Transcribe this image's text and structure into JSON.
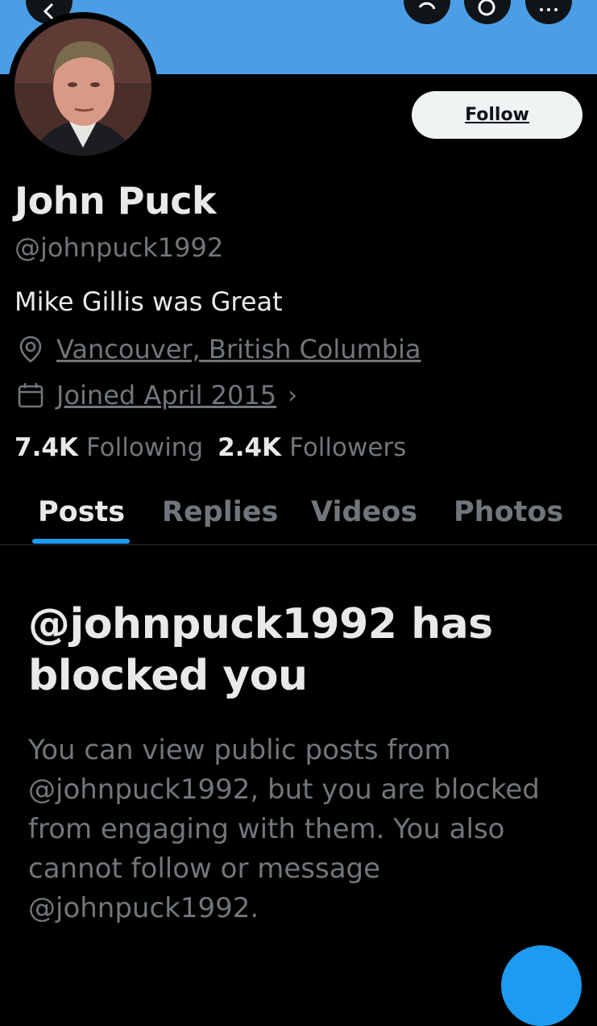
{
  "header": {
    "banner_color": "#4b9ee6",
    "icons": [
      "back-arrow-icon",
      "refresh-icon",
      "search-icon",
      "more-icon"
    ]
  },
  "profile": {
    "name": "John Puck",
    "handle": "@johnpuck1992",
    "bio": "Mike Gillis was Great",
    "location": "Vancouver, British Columbia",
    "joined": "Joined April 2015",
    "follow_label": "Follow"
  },
  "stats": {
    "following_count": "7.4K",
    "following_label": "Following",
    "followers_count": "2.4K",
    "followers_label": "Followers"
  },
  "tabs": [
    {
      "label": "Posts",
      "active": true
    },
    {
      "label": "Replies",
      "active": false
    },
    {
      "label": "Videos",
      "active": false
    },
    {
      "label": "Photos",
      "active": false
    }
  ],
  "blocked": {
    "title": "@johnpuck1992 has blocked you",
    "message": "You can view public posts from @johnpuck1992, but you are blocked from engaging with them. You also cannot follow or message @johnpuck1992."
  },
  "colors": {
    "accent": "#1d9bf0",
    "muted_text": "#71767b",
    "primary_text": "#e7e9ea"
  }
}
